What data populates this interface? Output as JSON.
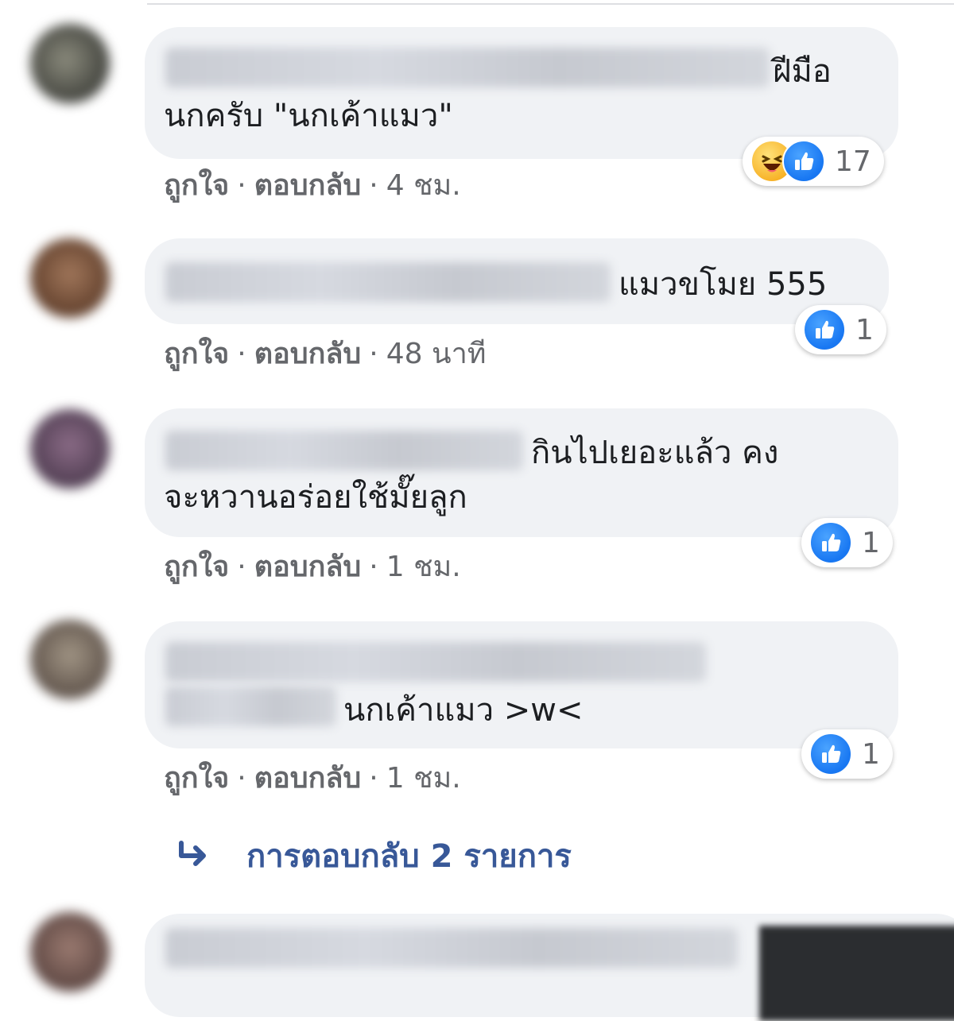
{
  "comments": [
    {
      "text_line1": "ฝีมือ",
      "text_line2": "นกครับ \"นกเค้าแมว\"",
      "actions": {
        "like": "ถูกใจ",
        "reply": "ตอบกลับ",
        "time": "4 ชม."
      },
      "reactions": {
        "icons": [
          "haha-icon",
          "like-icon"
        ],
        "count": "17"
      }
    },
    {
      "text_line1": "แมวขโมย 555",
      "text_line2": "",
      "actions": {
        "like": "ถูกใจ",
        "reply": "ตอบกลับ",
        "time": "48 นาที"
      },
      "reactions": {
        "icons": [
          "like-icon"
        ],
        "count": "1"
      }
    },
    {
      "text_line1": "กินไปเยอะแล้ว คง",
      "text_line2": "จะหวานอร่อยใช้มั๊ยลูก",
      "actions": {
        "like": "ถูกใจ",
        "reply": "ตอบกลับ",
        "time": "1 ชม."
      },
      "reactions": {
        "icons": [
          "like-icon"
        ],
        "count": "1"
      }
    },
    {
      "text_line1": "นกเค้าแมว >w<",
      "text_line2": "",
      "actions": {
        "like": "ถูกใจ",
        "reply": "ตอบกลับ",
        "time": "1 ชม."
      },
      "reactions": {
        "icons": [
          "like-icon"
        ],
        "count": "1"
      }
    }
  ],
  "more_replies": {
    "label": "การตอบกลับ 2 รายการ",
    "icon": "reply-arrow-icon"
  },
  "colors": {
    "bubble": "#f0f2f5",
    "link": "#385898",
    "like_blue": "#1877f2",
    "haha_yellow": "#f7b125",
    "meta_gray": "#65676b"
  }
}
